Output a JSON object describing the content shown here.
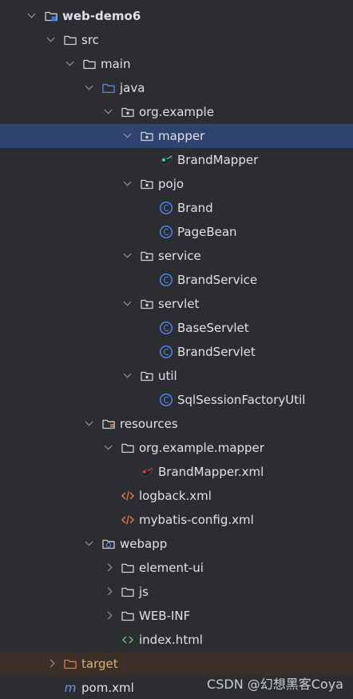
{
  "project": {
    "nodes": [
      {
        "label": "web-demo6",
        "icon": "module-folder-icon",
        "expander": "expanded",
        "state": "normal"
      },
      {
        "label": "src",
        "icon": "folder-icon",
        "expander": "expanded",
        "state": "normal"
      },
      {
        "label": "main",
        "icon": "folder-icon",
        "expander": "expanded",
        "state": "normal"
      },
      {
        "label": "java",
        "icon": "source-folder-icon",
        "expander": "expanded",
        "state": "normal"
      },
      {
        "label": "org.example",
        "icon": "package-icon",
        "expander": "expanded",
        "state": "normal"
      },
      {
        "label": "mapper",
        "icon": "package-icon",
        "expander": "expanded",
        "state": "selected"
      },
      {
        "label": "BrandMapper",
        "icon": "mybatis-mapper-icon",
        "expander": "none",
        "state": "normal"
      },
      {
        "label": "pojo",
        "icon": "package-icon",
        "expander": "expanded",
        "state": "normal"
      },
      {
        "label": "Brand",
        "icon": "java-class-icon",
        "expander": "none",
        "state": "normal"
      },
      {
        "label": "PageBean",
        "icon": "java-class-icon",
        "expander": "none",
        "state": "normal"
      },
      {
        "label": "service",
        "icon": "package-icon",
        "expander": "expanded",
        "state": "normal"
      },
      {
        "label": "BrandService",
        "icon": "java-class-icon",
        "expander": "none",
        "state": "normal"
      },
      {
        "label": "servlet",
        "icon": "package-icon",
        "expander": "expanded",
        "state": "normal"
      },
      {
        "label": "BaseServlet",
        "icon": "java-class-icon",
        "expander": "none",
        "state": "normal"
      },
      {
        "label": "BrandServlet",
        "icon": "java-class-icon",
        "expander": "none",
        "state": "normal"
      },
      {
        "label": "util",
        "icon": "package-icon",
        "expander": "expanded",
        "state": "normal"
      },
      {
        "label": "SqlSessionFactoryUtil",
        "icon": "java-class-icon",
        "expander": "none",
        "state": "normal"
      },
      {
        "label": "resources",
        "icon": "resources-folder-icon",
        "expander": "expanded",
        "state": "normal"
      },
      {
        "label": "org.example.mapper",
        "icon": "folder-icon",
        "expander": "expanded",
        "state": "normal"
      },
      {
        "label": "BrandMapper.xml",
        "icon": "mybatis-xml-icon",
        "expander": "none",
        "state": "normal"
      },
      {
        "label": "logback.xml",
        "icon": "xml-file-icon",
        "expander": "none",
        "state": "normal"
      },
      {
        "label": "mybatis-config.xml",
        "icon": "xml-file-icon",
        "expander": "none",
        "state": "normal"
      },
      {
        "label": "webapp",
        "icon": "web-folder-icon",
        "expander": "expanded",
        "state": "normal"
      },
      {
        "label": "element-ui",
        "icon": "folder-icon",
        "expander": "collapsed",
        "state": "normal"
      },
      {
        "label": "js",
        "icon": "folder-icon",
        "expander": "collapsed",
        "state": "normal"
      },
      {
        "label": "WEB-INF",
        "icon": "folder-icon",
        "expander": "collapsed",
        "state": "normal"
      },
      {
        "label": "index.html",
        "icon": "html-file-icon",
        "expander": "none",
        "state": "normal"
      },
      {
        "label": "target",
        "icon": "excluded-folder-icon",
        "expander": "collapsed",
        "state": "excluded"
      },
      {
        "label": "pom.xml",
        "icon": "maven-pom-icon",
        "expander": "none",
        "state": "normal"
      }
    ]
  },
  "watermark": "CSDN @幻想黑客Coya",
  "colors": {
    "background": "#2b2d30",
    "selection": "#2e436e",
    "excluded_row": "#3b2f27",
    "text": "#dfe1e5",
    "excluded_text": "#dcb07a",
    "class_icon": "#548af7",
    "folder_icon": "#ced0d6",
    "xml_icon": "#e8754a",
    "html_icon": "#5fb865"
  }
}
